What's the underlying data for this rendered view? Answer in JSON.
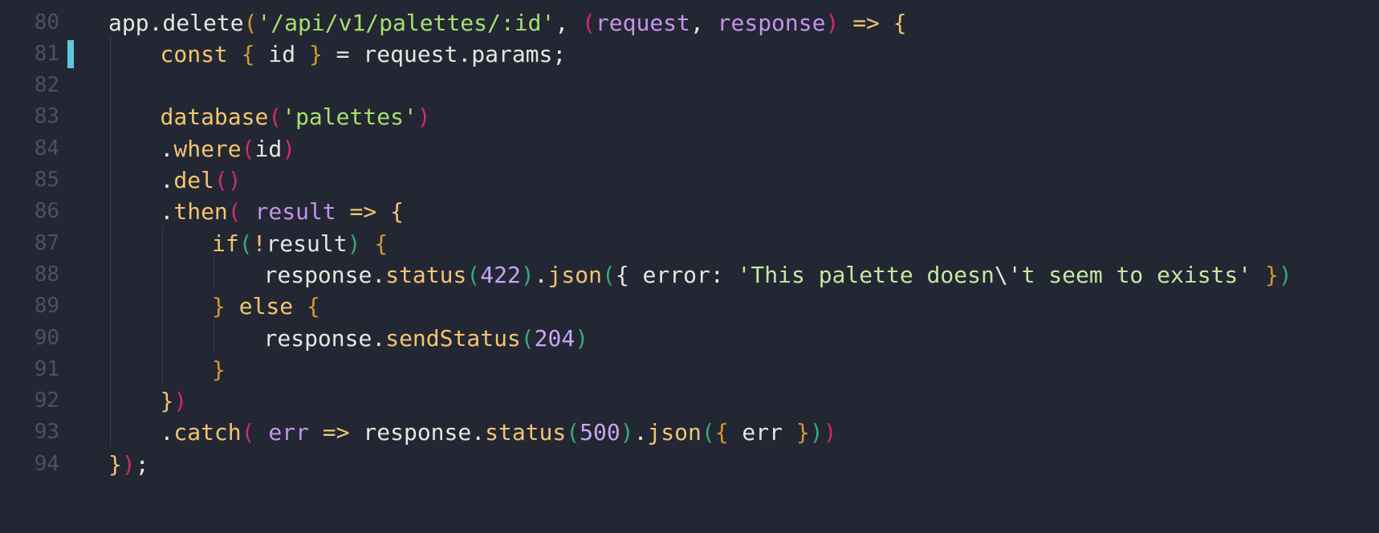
{
  "editor": {
    "language": "javascript",
    "theme_colors": {
      "background": "#222733",
      "line_number": "#4a5260",
      "modified_marker": "#5fc7dc",
      "plain": "#e8e6df",
      "string": "#a6e06b",
      "parameter": "#c792ea",
      "keyword_function": "#f4c46f",
      "number": "#c7a6f5"
    },
    "modified_line": "81",
    "lines": [
      {
        "num": "80",
        "indent": 0,
        "tokens": [
          {
            "t": "app.delete",
            "c": "p"
          },
          {
            "t": "(",
            "c": "po"
          },
          {
            "t": "'/api/v1/palettes/:id'",
            "c": "s"
          },
          {
            "t": ", ",
            "c": "p"
          },
          {
            "t": "(",
            "c": "pk"
          },
          {
            "t": "request",
            "c": "par"
          },
          {
            "t": ", ",
            "c": "p"
          },
          {
            "t": "response",
            "c": "par"
          },
          {
            "t": ")",
            "c": "pk"
          },
          {
            "t": " => ",
            "c": "y"
          },
          {
            "t": "{",
            "c": "y"
          }
        ]
      },
      {
        "num": "81",
        "indent": 1,
        "tokens": [
          {
            "t": "const",
            "c": "y"
          },
          {
            "t": " ",
            "c": "p"
          },
          {
            "t": "{",
            "c": "po"
          },
          {
            "t": " id ",
            "c": "p"
          },
          {
            "t": "}",
            "c": "po"
          },
          {
            "t": " = request.params;",
            "c": "p"
          }
        ]
      },
      {
        "num": "82",
        "indent": 1,
        "tokens": []
      },
      {
        "num": "83",
        "indent": 1,
        "tokens": [
          {
            "t": "database",
            "c": "y"
          },
          {
            "t": "(",
            "c": "pk"
          },
          {
            "t": "'palettes'",
            "c": "s"
          },
          {
            "t": ")",
            "c": "pk"
          }
        ]
      },
      {
        "num": "84",
        "indent": 1,
        "tokens": [
          {
            "t": ".",
            "c": "p"
          },
          {
            "t": "where",
            "c": "y"
          },
          {
            "t": "(",
            "c": "pk"
          },
          {
            "t": "id",
            "c": "p"
          },
          {
            "t": ")",
            "c": "pk"
          }
        ]
      },
      {
        "num": "85",
        "indent": 1,
        "tokens": [
          {
            "t": ".",
            "c": "p"
          },
          {
            "t": "del",
            "c": "y"
          },
          {
            "t": "()",
            "c": "pk"
          }
        ]
      },
      {
        "num": "86",
        "indent": 1,
        "tokens": [
          {
            "t": ".",
            "c": "p"
          },
          {
            "t": "then",
            "c": "y"
          },
          {
            "t": "(",
            "c": "pk"
          },
          {
            "t": " ",
            "c": "p"
          },
          {
            "t": "result",
            "c": "par"
          },
          {
            "t": " => ",
            "c": "y"
          },
          {
            "t": "{",
            "c": "y"
          }
        ]
      },
      {
        "num": "87",
        "indent": 2,
        "tokens": [
          {
            "t": "if",
            "c": "y"
          },
          {
            "t": "(",
            "c": "pg"
          },
          {
            "t": "!",
            "c": "y"
          },
          {
            "t": "result",
            "c": "p"
          },
          {
            "t": ")",
            "c": "pg"
          },
          {
            "t": " ",
            "c": "p"
          },
          {
            "t": "{",
            "c": "po"
          }
        ]
      },
      {
        "num": "88",
        "indent": 3,
        "tokens": [
          {
            "t": "response.",
            "c": "p"
          },
          {
            "t": "status",
            "c": "y"
          },
          {
            "t": "(",
            "c": "pg"
          },
          {
            "t": "422",
            "c": "n"
          },
          {
            "t": ")",
            "c": "pg"
          },
          {
            "t": ".",
            "c": "p"
          },
          {
            "t": "json",
            "c": "y"
          },
          {
            "t": "(",
            "c": "pg"
          },
          {
            "t": "{",
            "c": "p"
          },
          {
            "t": " error: ",
            "c": "p"
          },
          {
            "t": "'This palette doesn",
            "c": "s2"
          },
          {
            "t": "\\'",
            "c": "esc"
          },
          {
            "t": "t seem to exists'",
            "c": "s2"
          },
          {
            "t": " ",
            "c": "p"
          },
          {
            "t": "}",
            "c": "po"
          },
          {
            "t": ")",
            "c": "pg"
          }
        ]
      },
      {
        "num": "89",
        "indent": 2,
        "tokens": [
          {
            "t": "}",
            "c": "po"
          },
          {
            "t": " ",
            "c": "p"
          },
          {
            "t": "else",
            "c": "y"
          },
          {
            "t": " ",
            "c": "p"
          },
          {
            "t": "{",
            "c": "po"
          }
        ]
      },
      {
        "num": "90",
        "indent": 3,
        "tokens": [
          {
            "t": "response.",
            "c": "p"
          },
          {
            "t": "sendStatus",
            "c": "y"
          },
          {
            "t": "(",
            "c": "pg"
          },
          {
            "t": "204",
            "c": "n"
          },
          {
            "t": ")",
            "c": "pg"
          }
        ]
      },
      {
        "num": "91",
        "indent": 2,
        "tokens": [
          {
            "t": "}",
            "c": "po"
          }
        ]
      },
      {
        "num": "92",
        "indent": 1,
        "tokens": [
          {
            "t": "}",
            "c": "y"
          },
          {
            "t": ")",
            "c": "pk"
          }
        ]
      },
      {
        "num": "93",
        "indent": 1,
        "tokens": [
          {
            "t": ".",
            "c": "p"
          },
          {
            "t": "catch",
            "c": "y"
          },
          {
            "t": "(",
            "c": "pk"
          },
          {
            "t": " ",
            "c": "p"
          },
          {
            "t": "err",
            "c": "par"
          },
          {
            "t": " => ",
            "c": "y"
          },
          {
            "t": "response.",
            "c": "p"
          },
          {
            "t": "status",
            "c": "y"
          },
          {
            "t": "(",
            "c": "pg"
          },
          {
            "t": "500",
            "c": "n"
          },
          {
            "t": ")",
            "c": "pg"
          },
          {
            "t": ".",
            "c": "p"
          },
          {
            "t": "json",
            "c": "y"
          },
          {
            "t": "(",
            "c": "pg"
          },
          {
            "t": "{",
            "c": "po"
          },
          {
            "t": " err ",
            "c": "p"
          },
          {
            "t": "}",
            "c": "po"
          },
          {
            "t": ")",
            "c": "pg"
          },
          {
            "t": ")",
            "c": "pk"
          }
        ]
      },
      {
        "num": "94",
        "indent": 0,
        "tokens": [
          {
            "t": "}",
            "c": "y"
          },
          {
            "t": ")",
            "c": "pk"
          },
          {
            "t": ";",
            "c": "p"
          }
        ]
      }
    ]
  }
}
